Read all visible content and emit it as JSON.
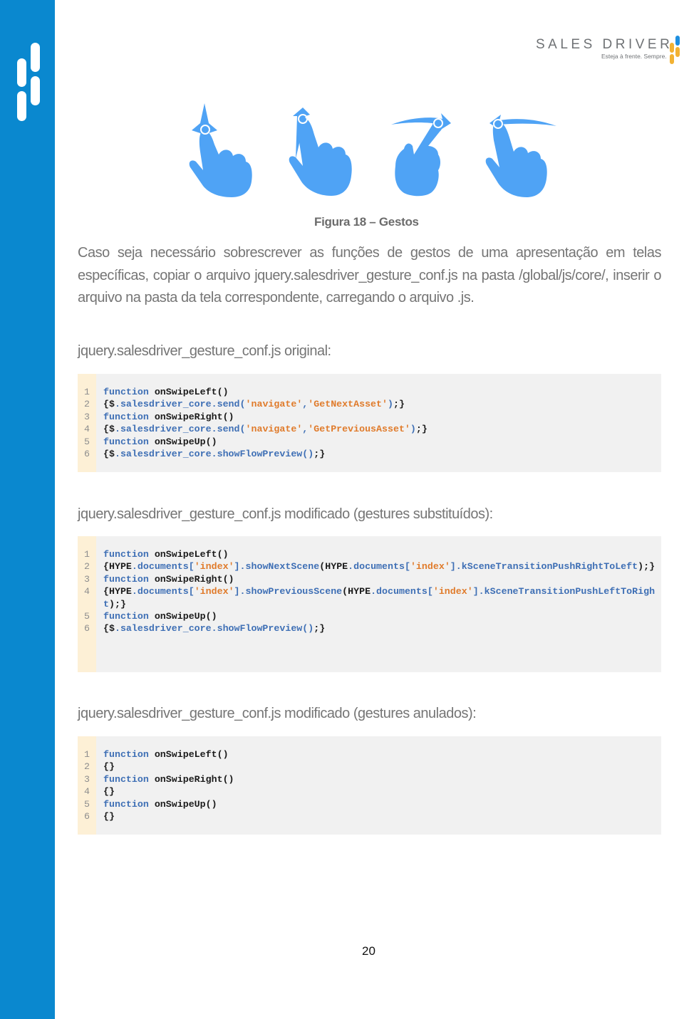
{
  "brand": {
    "name": "SALES DRIVER",
    "tagline": "Esteja à frente. Sempre.",
    "colors": {
      "sidebar": "#0a88cf",
      "gesture": "#4fa3f5",
      "mark_blue": "#1e8fe0",
      "mark_yellow": "#f2b233"
    }
  },
  "figure": {
    "gestures": [
      {
        "icon": "swipe-up-hand-icon"
      },
      {
        "icon": "swipe-up-left-hand-icon"
      },
      {
        "icon": "swipe-right-hand-icon"
      },
      {
        "icon": "swipe-left-hand-icon"
      }
    ],
    "caption": "Figura 18 – Gestos"
  },
  "paragraph": "Caso seja necessário sobrescrever as funções de gestos de uma apresentação em telas específicas, copiar o arquivo jquery.salesdriver_gesture_conf.js na pasta /global/js/core/, inserir o arquivo na pasta da tela correspondente, carregando o arquivo .js.",
  "sections": [
    {
      "heading": "jquery.salesdriver_gesture_conf.js original:",
      "lines": [
        {
          "n": "1",
          "tokens": [
            [
              "kw",
              "function "
            ],
            [
              "plain",
              "onSwipeLeft()"
            ]
          ]
        },
        {
          "n": "2",
          "tokens": [
            [
              "plain",
              "{$"
            ],
            [
              "mb",
              ".salesdriver_core.send("
            ],
            [
              "str",
              "'navigate'"
            ],
            [
              "mb",
              ","
            ],
            [
              "str",
              "'GetNextAsset'"
            ],
            [
              "mb",
              ")"
            ],
            [
              "plain",
              ";}"
            ]
          ]
        },
        {
          "n": "3",
          "tokens": [
            [
              "kw",
              "function "
            ],
            [
              "plain",
              "onSwipeRight()"
            ]
          ]
        },
        {
          "n": "4",
          "tokens": [
            [
              "plain",
              "{$"
            ],
            [
              "mb",
              ".salesdriver_core.send("
            ],
            [
              "str",
              "'navigate'"
            ],
            [
              "mb",
              ","
            ],
            [
              "str",
              "'GetPreviousAsset'"
            ],
            [
              "mb",
              ")"
            ],
            [
              "plain",
              ";}"
            ]
          ]
        },
        {
          "n": "5",
          "tokens": [
            [
              "kw",
              "function "
            ],
            [
              "plain",
              "onSwipeUp()"
            ]
          ]
        },
        {
          "n": "6",
          "tokens": [
            [
              "plain",
              "{$"
            ],
            [
              "mb",
              ".salesdriver_core.showFlowPreview()"
            ],
            [
              "plain",
              ";}"
            ]
          ]
        }
      ]
    },
    {
      "heading": "jquery.salesdriver_gesture_conf.js modificado (gestures substituídos):",
      "lines": [
        {
          "n": "1",
          "tokens": [
            [
              "kw",
              "function "
            ],
            [
              "plain",
              "onSwipeLeft()"
            ]
          ]
        },
        {
          "n": "2",
          "tokens": [
            [
              "plain",
              "{HYPE"
            ],
            [
              "mb",
              ".documents["
            ],
            [
              "str",
              "'index'"
            ],
            [
              "mb",
              "].showNextScene"
            ],
            [
              "plain",
              "(HYPE"
            ],
            [
              "mb",
              ".documents["
            ],
            [
              "str",
              "'index'"
            ],
            [
              "mb",
              "].kSceneTransitionPushR"
            ],
            [
              "mb",
              "ightToLeft"
            ],
            [
              "plain",
              ");}"
            ]
          ]
        },
        {
          "n": "3",
          "tokens": [
            [
              "kw",
              "function "
            ],
            [
              "plain",
              "onSwipeRight()"
            ]
          ]
        },
        {
          "n": "4",
          "tokens": [
            [
              "plain",
              "{HYPE"
            ],
            [
              "mb",
              ".documents["
            ],
            [
              "str",
              "'index'"
            ],
            [
              "mb",
              "].showPreviousScene"
            ],
            [
              "plain",
              "(HYPE"
            ],
            [
              "mb",
              ".documents["
            ],
            [
              "str",
              "'index'"
            ],
            [
              "mb",
              "].kSceneTransitionP"
            ],
            [
              "mb",
              "ushLeftToRight"
            ],
            [
              "plain",
              ");}"
            ]
          ]
        },
        {
          "n": "5",
          "tokens": [
            [
              "kw",
              "function "
            ],
            [
              "plain",
              "onSwipeUp()"
            ]
          ]
        },
        {
          "n": "6",
          "tokens": [
            [
              "plain",
              "{$"
            ],
            [
              "mb",
              ".salesdriver_core.showFlowPreview()"
            ],
            [
              "plain",
              ";}"
            ]
          ]
        }
      ]
    },
    {
      "heading": "jquery.salesdriver_gesture_conf.js modificado (gestures anulados):",
      "lines": [
        {
          "n": "1",
          "tokens": [
            [
              "kw",
              "function "
            ],
            [
              "plain",
              "onSwipeLeft()"
            ]
          ]
        },
        {
          "n": "2",
          "tokens": [
            [
              "plain",
              "{}"
            ]
          ]
        },
        {
          "n": "3",
          "tokens": [
            [
              "kw",
              "function "
            ],
            [
              "plain",
              "onSwipeRight()"
            ]
          ]
        },
        {
          "n": "4",
          "tokens": [
            [
              "plain",
              "{}"
            ]
          ]
        },
        {
          "n": "5",
          "tokens": [
            [
              "kw",
              "function "
            ],
            [
              "plain",
              "onSwipeUp()"
            ]
          ]
        },
        {
          "n": "6",
          "tokens": [
            [
              "plain",
              "{}"
            ]
          ]
        }
      ]
    }
  ],
  "page_number": "20"
}
